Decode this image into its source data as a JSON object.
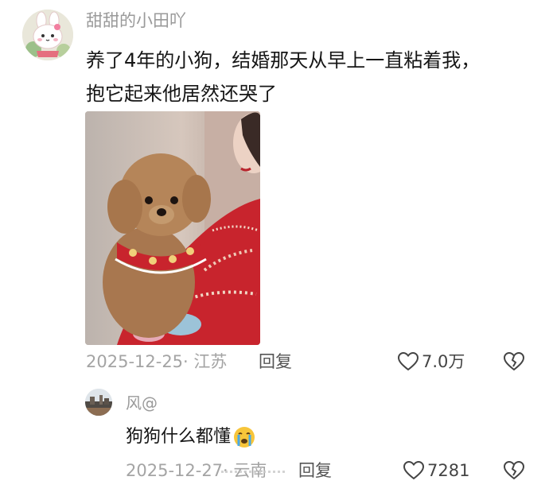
{
  "comment": {
    "username": "甜甜的小田吖",
    "text_line1": "养了4年的小狗，结婚那天从早上一直粘着我，",
    "text_line2": "抱它起来他居然还哭了",
    "date_location": "2025-12-25· 江苏",
    "reply_label": "回复",
    "like_count": "7.0万",
    "avatar_icon": "cartoon-bunny-avatar",
    "photo_subject": "poodle-dog-held-by-bride"
  },
  "reply": {
    "username": "风@",
    "text": "狗狗什么都懂",
    "emoji": "crying-face-emoji",
    "date_location": "2025-12-27· 云南",
    "reply_label": "回复",
    "like_count": "7281"
  },
  "colors": {
    "meta_text": "#a4a4a4",
    "username": "#9a9a9a",
    "body_text": "#161616",
    "dress_red": "#c8242d"
  }
}
